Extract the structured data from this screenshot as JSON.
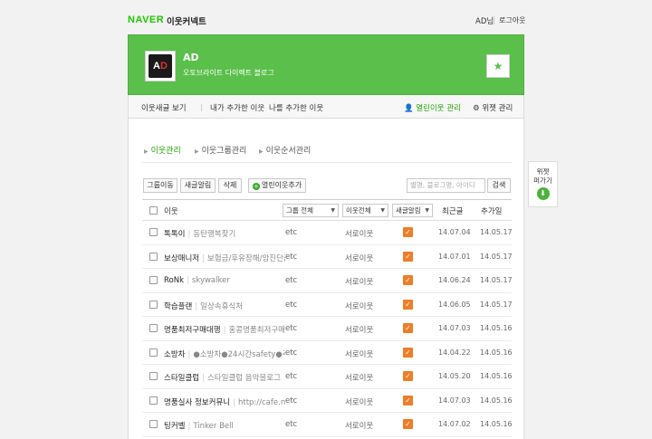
{
  "topbar": {
    "brand": "NAVER",
    "service": "이웃커넥트",
    "user": "AD님",
    "logout": "로그아웃"
  },
  "header": {
    "logo_text_a": "A",
    "logo_text_d": "D",
    "title": "AD",
    "subtitle": "오토브라이트 다이렉트 블로그",
    "favorite_icon": "star-icon"
  },
  "nav": {
    "items": [
      "이웃새글 보기",
      "내가 추가한 이웃",
      "나를 추가한 이웃"
    ],
    "manage": "열린이웃 관리",
    "widget": "위젯 관리"
  },
  "subtabs": [
    "이웃관리",
    "이웃그룹관리",
    "이웃순서관리"
  ],
  "toolbar": {
    "buttons": [
      "그룹이동",
      "새글알림",
      "삭제"
    ],
    "add_label": "열린이웃추가",
    "search_placeholder": "별명, 블로그명, 아이디",
    "search_label": "검색"
  },
  "table": {
    "headers": {
      "neighbor": "이웃",
      "group": "그룹 전체",
      "relation": "이웃전체",
      "alert": "새글알림",
      "latest": "최근글",
      "added": "추가일"
    },
    "rows": [
      {
        "name": "톡톡이",
        "blog": "동탄행복찾기",
        "group": "etc",
        "relation": "서로이웃",
        "alert": true,
        "latest": "14.07.04",
        "added": "14.05.17"
      },
      {
        "name": "보상매니저",
        "blog": "보험금/후유장해/암진단금",
        "group": "etc",
        "relation": "서로이웃",
        "alert": true,
        "latest": "14.07.01",
        "added": "14.05.17"
      },
      {
        "name": "RoNk",
        "blog": "skywalker",
        "group": "etc",
        "relation": "서로이웃",
        "alert": true,
        "latest": "14.06.24",
        "added": "14.05.17"
      },
      {
        "name": "학습플랜",
        "blog": "일상속휴식처",
        "group": "etc",
        "relation": "서로이웃",
        "alert": true,
        "latest": "14.06.05",
        "added": "14.05.17"
      },
      {
        "name": "명품최저구매대행",
        "blog": "홍콩명품최저구매대",
        "group": "etc",
        "relation": "서로이웃",
        "alert": true,
        "latest": "14.07.03",
        "added": "14.05.16"
      },
      {
        "name": "소방차",
        "blog": "●소방차●24시간safety●주",
        "group": "etc",
        "relation": "서로이웃",
        "alert": true,
        "latest": "14.04.22",
        "added": "14.05.16"
      },
      {
        "name": "스타일클럽",
        "blog": "스타일클럽 음악블로그",
        "group": "etc",
        "relation": "서로이웃",
        "alert": true,
        "latest": "14.05.20",
        "added": "14.05.16"
      },
      {
        "name": "명품실사 정보커뮤니",
        "blog": "http://cafe.naver.com",
        "group": "etc",
        "relation": "서로이웃",
        "alert": true,
        "latest": "14.07.03",
        "added": "14.05.16"
      },
      {
        "name": "팅커벨",
        "blog": "Tinker Bell",
        "group": "etc",
        "relation": "서로이웃",
        "alert": true,
        "latest": "14.07.02",
        "added": "14.05.16"
      }
    ]
  },
  "widget_side": {
    "line1": "위젯",
    "line2": "퍼가기",
    "icon": "download-icon"
  },
  "colors": {
    "brand_green": "#5bbf4b",
    "accent_orange": "#f07c28",
    "link_green": "#1fa300"
  }
}
